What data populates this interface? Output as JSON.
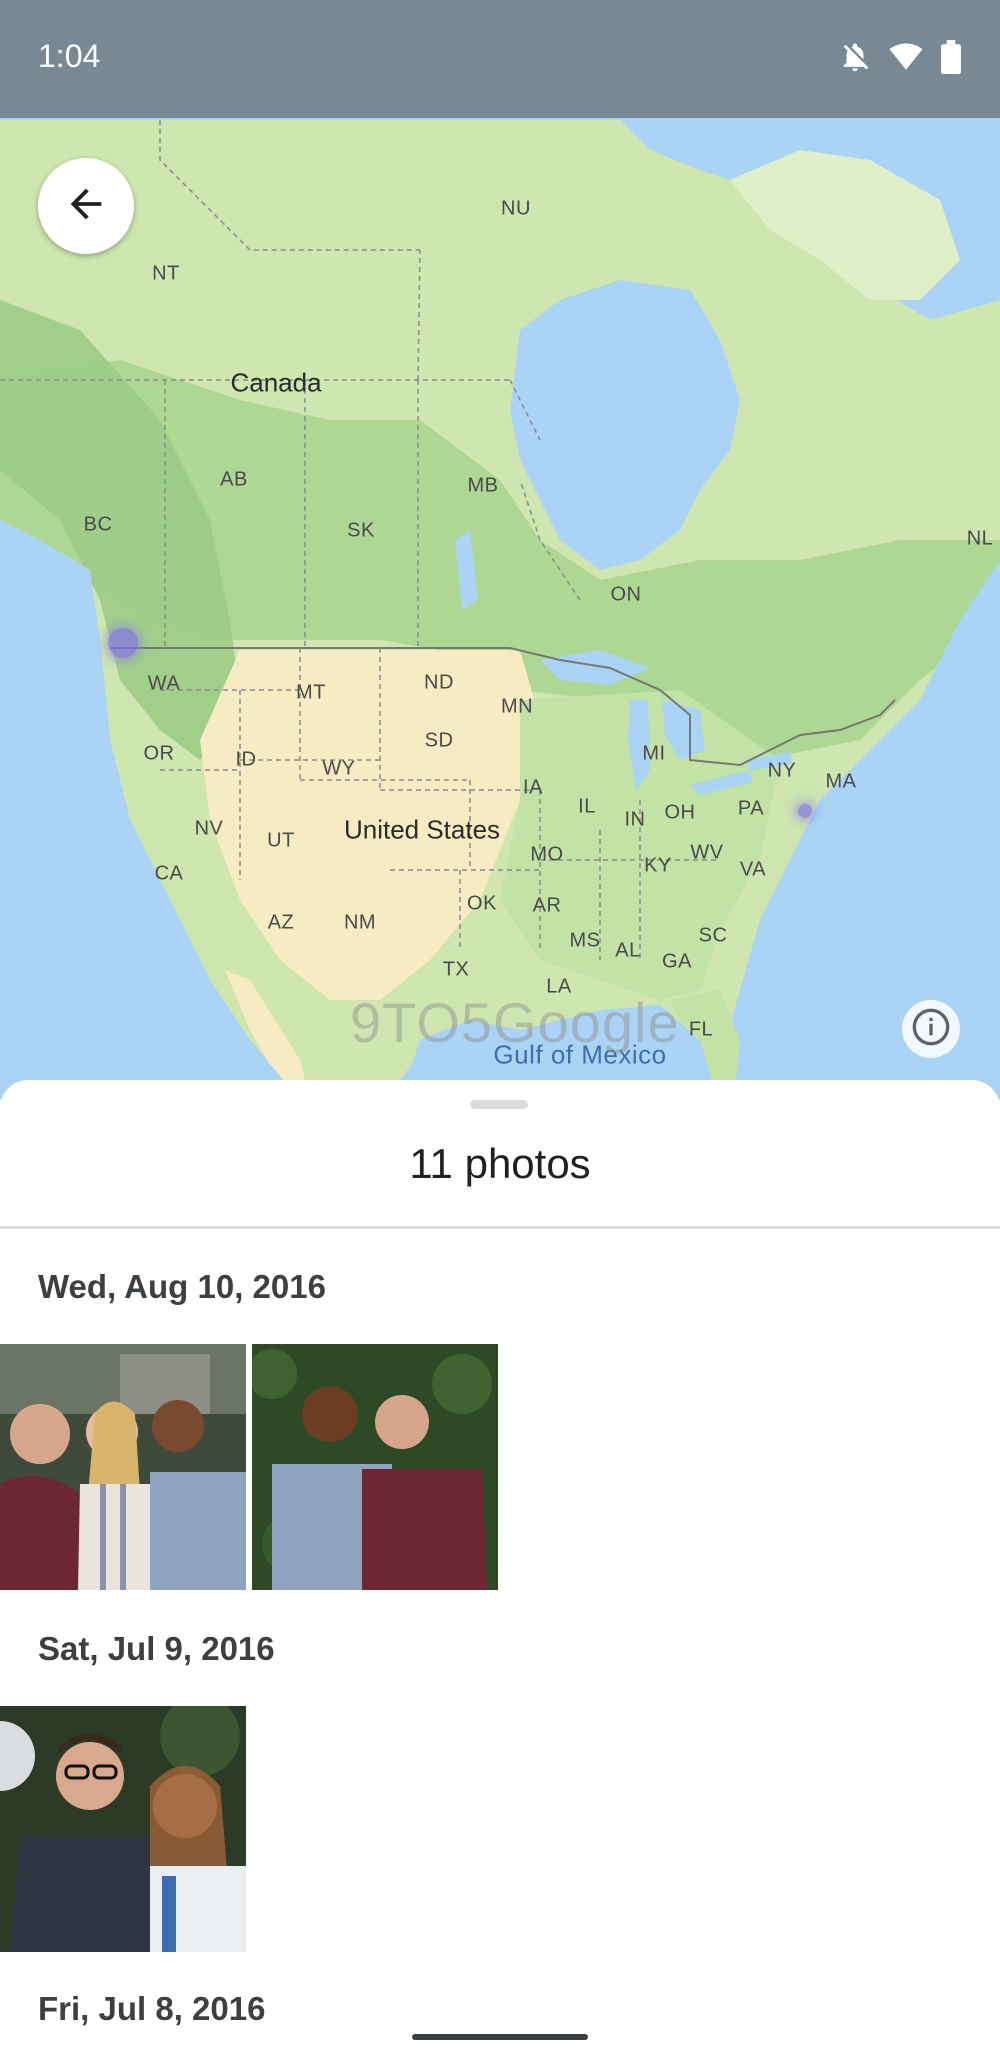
{
  "status_bar": {
    "time": "1:04",
    "icons": [
      "notifications-off-icon",
      "wifi-icon",
      "battery-icon"
    ]
  },
  "map": {
    "country_labels": [
      "Canada",
      "United States"
    ],
    "region_labels": [
      "NU",
      "NT",
      "AB",
      "BC",
      "SK",
      "MB",
      "ON",
      "NL",
      "WA",
      "MT",
      "ND",
      "MN",
      "OR",
      "ID",
      "WY",
      "SD",
      "MI",
      "NY",
      "MA",
      "IA",
      "IL",
      "PA",
      "NV",
      "UT",
      "IN",
      "OH",
      "CA",
      "MO",
      "KY",
      "WV",
      "VA",
      "OK",
      "AR",
      "AZ",
      "NM",
      "MS",
      "AL",
      "SC",
      "TX",
      "GA",
      "LA",
      "FL"
    ],
    "water_label": "Gulf of Mexico",
    "watermark": "9TO5Google",
    "colors": {
      "water": "#aad3f5",
      "land_green": "#cfe6b0",
      "land_forest": "#9ccf86",
      "land_desert": "#f7ebc3",
      "pin": "#8a72ee"
    }
  },
  "buttons": {
    "back_icon": "arrow-back-icon",
    "info_icon": "info-icon"
  },
  "sheet": {
    "title": "11 photos",
    "groups": [
      {
        "date": "Wed, Aug 10, 2016",
        "photos": [
          "group-photo-three-friends",
          "two-friends-photo"
        ]
      },
      {
        "date": "Sat, Jul 9, 2016",
        "photos": [
          "couple-selfie-photo"
        ]
      },
      {
        "date": "Fri, Jul 8, 2016",
        "photos": []
      }
    ]
  }
}
